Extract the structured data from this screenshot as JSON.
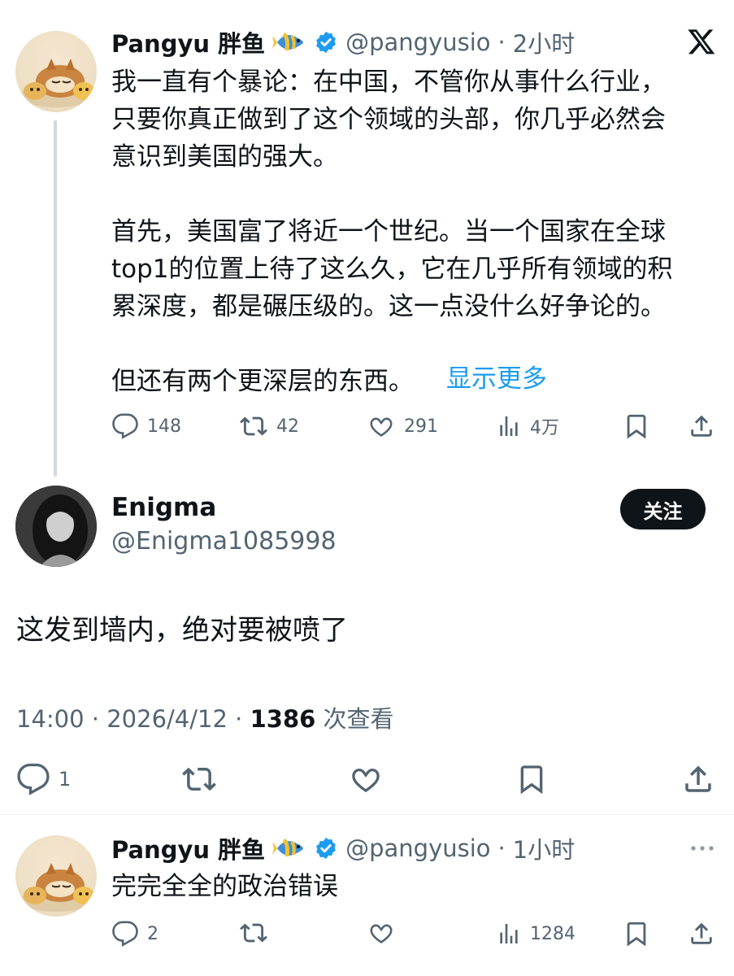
{
  "tweet1": {
    "name": "Pangyu 胖鱼",
    "handle": "@pangyusio",
    "dot": "·",
    "time": "2小时",
    "text": "我一直有个暴论：在中国，不管你从事什么行业，\n只要你真正做到了这个领域的头部，你几乎必然会\n意识到美国的强大。\n\n首先，美国富了将近一个世纪。当一个国家在全球\ntop1的位置上待了这么久，它在几乎所有领域的积\n累深度，都是碾压级的。这一点没什么好争论的。\n\n但还有两个更深层的东西。",
    "show_more": "显示更多",
    "stats": {
      "replies": "148",
      "reposts": "42",
      "likes": "291",
      "views": "4万"
    },
    "icons": [
      "fish-emoji",
      "verified-badge-icon",
      "x-logo"
    ]
  },
  "tweet2": {
    "name": "Enigma",
    "handle": "@Enigma1085998",
    "follow_label": "关注",
    "text": "这发到墙内，绝对要被喷了",
    "time": "14:00",
    "dot": "·",
    "date": "2026/4/12",
    "views_count": "1386",
    "views_label": "次查看",
    "stats": {
      "replies": "1"
    }
  },
  "tweet3": {
    "name": "Pangyu 胖鱼",
    "handle": "@pangyusio",
    "dot": "·",
    "time": "1小时",
    "text": "完完全全的政治错误",
    "stats": {
      "replies": "2",
      "views": "1284"
    }
  },
  "colors": {
    "text": "#0f1419",
    "secondary": "#536471",
    "link": "#1d9bf0",
    "verified": "#1d9bf0",
    "line": "#cfd9de"
  }
}
